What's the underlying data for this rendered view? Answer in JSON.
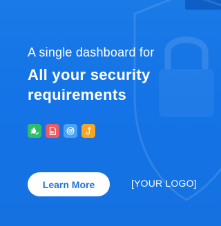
{
  "ad": {
    "headline_line1": "A single dashboard for",
    "headline_line2": "All your security requirements",
    "cta_label": "Learn More",
    "logo_placeholder": "[YOUR LOGO]",
    "background_color": "#1473e6",
    "background_icon": "shield-lock-icon",
    "feature_icons": [
      {
        "name": "bug-check-icon",
        "color": "#2fbd6b"
      },
      {
        "name": "document-key-icon",
        "color": "#ee5a5f"
      },
      {
        "name": "target-icon",
        "color": "#4aa3f2"
      },
      {
        "name": "hook-icon",
        "color": "#f5a623"
      }
    ]
  }
}
